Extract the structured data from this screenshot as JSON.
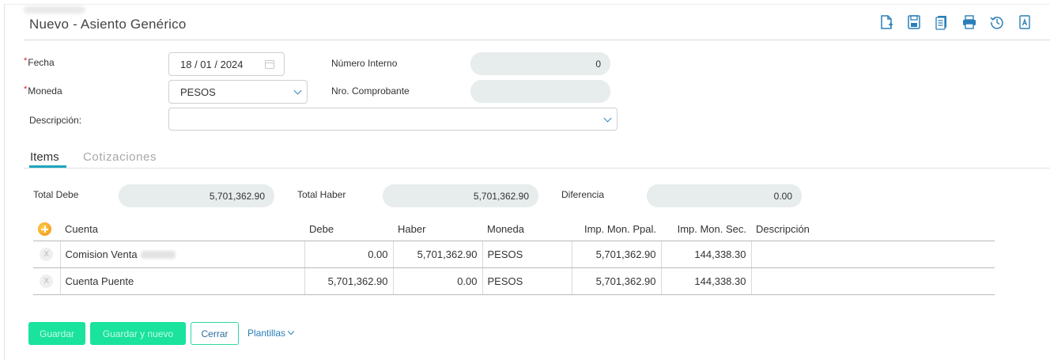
{
  "header": {
    "title": "Nuevo - Asiento Genérico",
    "toolbar": [
      "new-document-icon",
      "save-icon",
      "copy-icon",
      "print-icon",
      "history-icon",
      "pdf-icon"
    ]
  },
  "form": {
    "fecha": {
      "label": "Fecha",
      "value": "18 / 01 / 2024"
    },
    "moneda": {
      "label": "Moneda",
      "value": "PESOS"
    },
    "descripcion": {
      "label": "Descripción:",
      "value": ""
    },
    "numero_interno": {
      "label": "Número Interno",
      "value": "0"
    },
    "nro_comprobante": {
      "label": "Nro. Comprobante",
      "value": ""
    }
  },
  "tabs": [
    {
      "label": "Items",
      "active": true
    },
    {
      "label": "Cotizaciones",
      "active": false
    }
  ],
  "totals": {
    "debe": {
      "label": "Total Debe",
      "value": "5,701,362.90"
    },
    "haber": {
      "label": "Total Haber",
      "value": "5,701,362.90"
    },
    "diferencia": {
      "label": "Diferencia",
      "value": "0.00"
    }
  },
  "table": {
    "columns": [
      "Cuenta",
      "Debe",
      "Haber",
      "Moneda",
      "Imp. Mon. Ppal.",
      "Imp. Mon. Sec.",
      "Descripción"
    ],
    "rows": [
      {
        "cuenta": "Comision Venta",
        "debe": "0.00",
        "haber": "5,701,362.90",
        "moneda": "PESOS",
        "imp_ppal": "5,701,362.90",
        "imp_sec": "144,338.30",
        "descripcion": ""
      },
      {
        "cuenta": "Cuenta Puente",
        "debe": "5,701,362.90",
        "haber": "0.00",
        "moneda": "PESOS",
        "imp_ppal": "5,701,362.90",
        "imp_sec": "144,338.30",
        "descripcion": ""
      }
    ]
  },
  "footer": {
    "guardar": "Guardar",
    "guardar_nuevo": "Guardar y nuevo",
    "cerrar": "Cerrar",
    "plantillas": "Plantillas"
  },
  "colors": {
    "accent": "#1fa6bd",
    "primary_button": "#19e39c",
    "link": "#2a7fb8",
    "required": "#e0202a"
  }
}
